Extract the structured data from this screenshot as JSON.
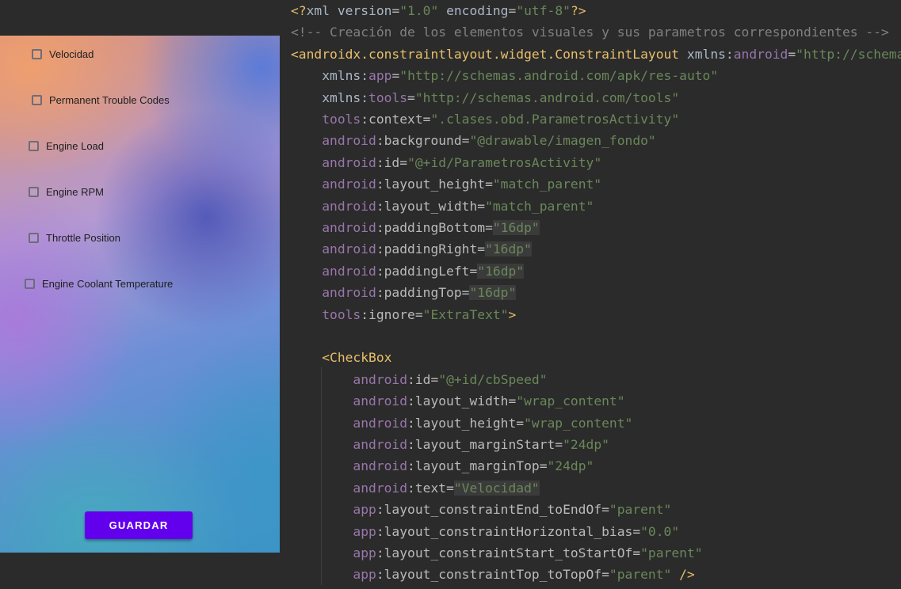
{
  "preview": {
    "checkboxes": [
      {
        "label": "Velocidad",
        "checked": false
      },
      {
        "label": "Permanent Trouble Codes",
        "checked": false
      },
      {
        "label": "Engine Load",
        "checked": false
      },
      {
        "label": "Engine RPM",
        "checked": false
      },
      {
        "label": "Throttle Position",
        "checked": false
      },
      {
        "label": "Engine Coolant Temperature",
        "checked": false
      }
    ],
    "button_label": "GUARDAR",
    "button_color": "#6200ee"
  },
  "editor": {
    "lines": [
      {
        "tokens": [
          [
            "pi",
            "<?"
          ],
          [
            "txt",
            "xml version"
          ],
          [
            "attr",
            "="
          ],
          [
            "val",
            "\"1.0\""
          ],
          [
            "txt",
            " encoding"
          ],
          [
            "attr",
            "="
          ],
          [
            "val",
            "\"utf-8\""
          ],
          [
            "pi",
            "?>"
          ]
        ]
      },
      {
        "tokens": [
          [
            "cmt",
            "<!-- Creación de los elementos visuales y sus parametros correspondientes -->"
          ]
        ]
      },
      {
        "tokens": [
          [
            "tag",
            "<androidx.constraintlayout.widget.ConstraintLayout"
          ],
          [
            "txt",
            " xmlns:"
          ],
          [
            "ns",
            "android"
          ],
          [
            "attr",
            "="
          ],
          [
            "val",
            "\"http://schemas.android.com/apk/res/android\""
          ]
        ]
      },
      {
        "tokens": [
          [
            "txt",
            "    xmlns:"
          ],
          [
            "ns",
            "app"
          ],
          [
            "attr",
            "="
          ],
          [
            "val",
            "\"http://schemas.android.com/apk/res-auto\""
          ]
        ]
      },
      {
        "tokens": [
          [
            "txt",
            "    xmlns:"
          ],
          [
            "ns",
            "tools"
          ],
          [
            "attr",
            "="
          ],
          [
            "val",
            "\"http://schemas.android.com/tools\""
          ]
        ]
      },
      {
        "tokens": [
          [
            "ns",
            "    tools"
          ],
          [
            "attr",
            ":context"
          ],
          [
            "attr",
            "="
          ],
          [
            "val",
            "\".clases.obd.ParametrosActivity\""
          ]
        ]
      },
      {
        "tokens": [
          [
            "ns",
            "    android"
          ],
          [
            "attr",
            ":background"
          ],
          [
            "attr",
            "="
          ],
          [
            "val",
            "\"@drawable/imagen_fondo\""
          ]
        ]
      },
      {
        "tokens": [
          [
            "ns",
            "    android"
          ],
          [
            "attr",
            ":id"
          ],
          [
            "attr",
            "="
          ],
          [
            "val",
            "\"@+id/ParametrosActivity\""
          ]
        ]
      },
      {
        "tokens": [
          [
            "ns",
            "    android"
          ],
          [
            "attr",
            ":layout_height"
          ],
          [
            "attr",
            "="
          ],
          [
            "val",
            "\"match_parent\""
          ]
        ]
      },
      {
        "tokens": [
          [
            "ns",
            "    android"
          ],
          [
            "attr",
            ":layout_width"
          ],
          [
            "attr",
            "="
          ],
          [
            "val",
            "\"match_parent\""
          ]
        ]
      },
      {
        "tokens": [
          [
            "ns",
            "    android"
          ],
          [
            "attr",
            ":paddingBottom"
          ],
          [
            "attr",
            "="
          ],
          [
            "valhl",
            "\"16dp\""
          ]
        ]
      },
      {
        "tokens": [
          [
            "ns",
            "    android"
          ],
          [
            "attr",
            ":paddingRight"
          ],
          [
            "attr",
            "="
          ],
          [
            "valhl",
            "\"16dp\""
          ]
        ]
      },
      {
        "tokens": [
          [
            "ns",
            "    android"
          ],
          [
            "attr",
            ":paddingLeft"
          ],
          [
            "attr",
            "="
          ],
          [
            "valhl",
            "\"16dp\""
          ]
        ]
      },
      {
        "tokens": [
          [
            "ns",
            "    android"
          ],
          [
            "attr",
            ":paddingTop"
          ],
          [
            "attr",
            "="
          ],
          [
            "valhl",
            "\"16dp\""
          ]
        ]
      },
      {
        "tokens": [
          [
            "ns",
            "    tools"
          ],
          [
            "attr",
            ":ignore"
          ],
          [
            "attr",
            "="
          ],
          [
            "val",
            "\"ExtraText\""
          ],
          [
            "tag",
            ">"
          ]
        ]
      },
      {
        "tokens": []
      },
      {
        "tokens": [
          [
            "tag",
            "    <CheckBox"
          ]
        ]
      },
      {
        "tokens": [
          [
            "ns",
            "        android"
          ],
          [
            "attr",
            ":id"
          ],
          [
            "attr",
            "="
          ],
          [
            "val",
            "\"@+id/cbSpeed\""
          ]
        ]
      },
      {
        "tokens": [
          [
            "ns",
            "        android"
          ],
          [
            "attr",
            ":layout_width"
          ],
          [
            "attr",
            "="
          ],
          [
            "val",
            "\"wrap_content\""
          ]
        ]
      },
      {
        "tokens": [
          [
            "ns",
            "        android"
          ],
          [
            "attr",
            ":layout_height"
          ],
          [
            "attr",
            "="
          ],
          [
            "val",
            "\"wrap_content\""
          ]
        ]
      },
      {
        "tokens": [
          [
            "ns",
            "        android"
          ],
          [
            "attr",
            ":layout_marginStart"
          ],
          [
            "attr",
            "="
          ],
          [
            "val",
            "\"24dp\""
          ]
        ]
      },
      {
        "tokens": [
          [
            "ns",
            "        android"
          ],
          [
            "attr",
            ":layout_marginTop"
          ],
          [
            "attr",
            "="
          ],
          [
            "val",
            "\"24dp\""
          ]
        ]
      },
      {
        "tokens": [
          [
            "ns",
            "        android"
          ],
          [
            "attr",
            ":text"
          ],
          [
            "attr",
            "="
          ],
          [
            "valhl",
            "\"Velocidad\""
          ]
        ]
      },
      {
        "tokens": [
          [
            "ns",
            "        app"
          ],
          [
            "attr",
            ":layout_constraintEnd_toEndOf"
          ],
          [
            "attr",
            "="
          ],
          [
            "val",
            "\"parent\""
          ]
        ]
      },
      {
        "tokens": [
          [
            "ns",
            "        app"
          ],
          [
            "attr",
            ":layout_constraintHorizontal_bias"
          ],
          [
            "attr",
            "="
          ],
          [
            "val",
            "\"0.0\""
          ]
        ]
      },
      {
        "tokens": [
          [
            "ns",
            "        app"
          ],
          [
            "attr",
            ":layout_constraintStart_toStartOf"
          ],
          [
            "attr",
            "="
          ],
          [
            "val",
            "\"parent\""
          ]
        ]
      },
      {
        "tokens": [
          [
            "ns",
            "        app"
          ],
          [
            "attr",
            ":layout_constraintTop_toTopOf"
          ],
          [
            "attr",
            "="
          ],
          [
            "val",
            "\"parent\""
          ],
          [
            "tag",
            " />"
          ]
        ]
      }
    ]
  }
}
